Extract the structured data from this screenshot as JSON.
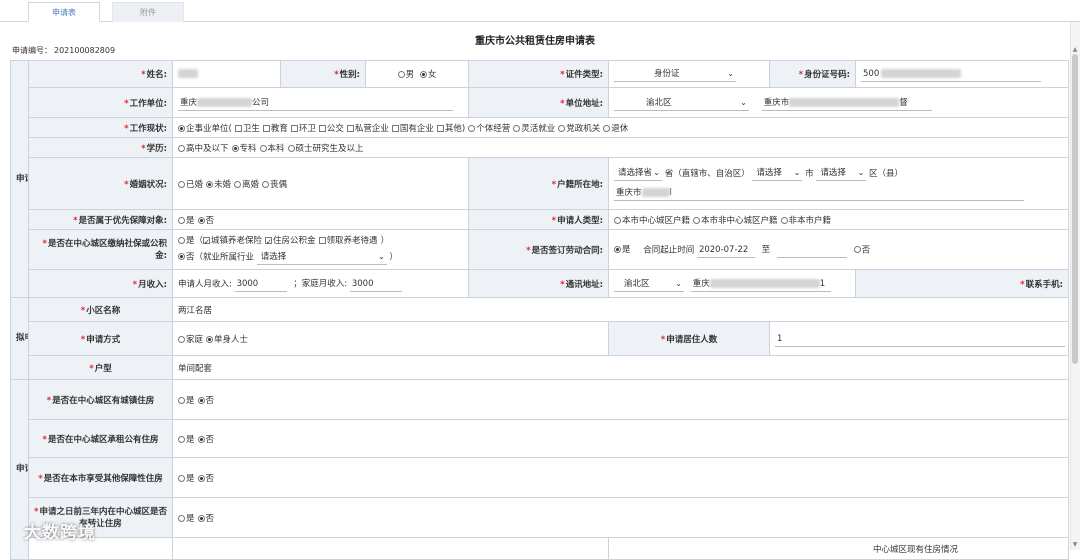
{
  "tabs": [
    "申请表",
    "附件"
  ],
  "form_title": "重庆市公共租赁住房申请表",
  "app_no": {
    "label": "申请编号：",
    "value": "202100082809"
  },
  "sections": {
    "basic": "申请人基本情况",
    "house": "拟申请房屋情况",
    "housing": "申请人及共同申请人住房情况"
  },
  "name": {
    "label": "姓名:"
  },
  "gender": {
    "label": "性别:",
    "options": [
      "男",
      "女"
    ],
    "selected": "女"
  },
  "id_type": {
    "label": "证件类型:",
    "value": "身份证"
  },
  "id_no": {
    "label": "身份证号码:",
    "value": "500"
  },
  "work_unit": {
    "label": "工作单位:",
    "prefix": "重庆",
    "suffix": "公司"
  },
  "unit_address": {
    "label": "单位地址:",
    "district": "渝北区",
    "detail_prefix": "重庆市",
    "detail_suffix": "督"
  },
  "work_status": {
    "label": "工作现状:",
    "items": [
      {
        "t": "radio",
        "on": true,
        "text": "企事业单位("
      },
      {
        "t": "chk",
        "on": false,
        "text": "卫生"
      },
      {
        "t": "chk",
        "on": false,
        "text": "教育"
      },
      {
        "t": "chk",
        "on": false,
        "text": "环卫"
      },
      {
        "t": "chk",
        "on": false,
        "text": "公交"
      },
      {
        "t": "chk",
        "on": false,
        "text": "私营企业"
      },
      {
        "t": "chk",
        "on": false,
        "text": "国有企业"
      },
      {
        "t": "chk",
        "on": false,
        "text": "其他)"
      },
      {
        "t": "radio",
        "on": false,
        "text": "个体经营"
      },
      {
        "t": "radio",
        "on": false,
        "text": "灵活就业"
      },
      {
        "t": "radio",
        "on": false,
        "text": "党政机关"
      },
      {
        "t": "radio",
        "on": false,
        "text": "退休"
      }
    ]
  },
  "education": {
    "label": "学历:",
    "items": [
      {
        "on": false,
        "text": "高中及以下"
      },
      {
        "on": true,
        "text": "专科"
      },
      {
        "on": false,
        "text": "本科"
      },
      {
        "on": false,
        "text": "硕士研究生及以上"
      }
    ]
  },
  "marital": {
    "label": "婚姻状况:",
    "items": [
      {
        "on": false,
        "text": "已婚"
      },
      {
        "on": true,
        "text": "未婚"
      },
      {
        "on": false,
        "text": "离婚"
      },
      {
        "on": false,
        "text": "丧偶"
      }
    ]
  },
  "hukou": {
    "label": "户籍所在地:",
    "sel1": "请选择省",
    "t1": "省（直辖市、自治区）",
    "sel2": "请选择",
    "t2": "市",
    "sel3": "请选择",
    "t3": "区（县）",
    "detail_prefix": "重庆市",
    "detail_suffix": "l"
  },
  "priority": {
    "label": "是否属于优先保障对象:",
    "items": [
      {
        "on": false,
        "text": "是"
      },
      {
        "on": true,
        "text": "否"
      }
    ]
  },
  "applicant_type": {
    "label": "申请人类型:",
    "items": [
      {
        "on": false,
        "text": "本市中心城区户籍"
      },
      {
        "on": false,
        "text": "本市非中心城区户籍"
      },
      {
        "on": false,
        "text": "非本市户籍"
      }
    ]
  },
  "social_ins": {
    "label": "是否在中心城区缴纳社保或公积金:",
    "line1_yes": "是（",
    "checks": [
      {
        "on": true,
        "text": "城镇养老保险"
      },
      {
        "on": true,
        "text": "住房公积金"
      },
      {
        "on": false,
        "text": "领取养老待遇"
      }
    ],
    "line1_end": "）",
    "line2_no": "否（就业所属行业",
    "industry_sel": "请选择",
    "line2_end": "）"
  },
  "contract": {
    "label": "是否签订劳动合同:",
    "yes": "是",
    "period_label": "合同起止时间",
    "start": "2020-07-22",
    "to": "至",
    "no": "否"
  },
  "income": {
    "label": "月收入:",
    "applicant_label": "申请人月收入:",
    "applicant": "3000",
    "family_label": "；家庭月收入:",
    "family": "3000"
  },
  "mail_addr": {
    "label": "通讯地址:",
    "district": "渝北区",
    "detail_prefix": "重庆",
    "detail_suffix": "1"
  },
  "phone": {
    "label": "联系手机:",
    "prefix": "17",
    "suffix": "1"
  },
  "community": {
    "label": "小区名称",
    "value": "两江名居"
  },
  "apply_mode": {
    "label": "申请方式",
    "items": [
      {
        "on": false,
        "text": "家庭"
      },
      {
        "on": true,
        "text": "单身人士"
      }
    ]
  },
  "residents": {
    "label": "申请居住人数",
    "value": "1"
  },
  "layout_type": {
    "label": "户型",
    "value": "单间配套"
  },
  "q1": {
    "label": "是否在中心城区有城镇住房",
    "items": [
      {
        "on": false,
        "text": "是"
      },
      {
        "on": true,
        "text": "否"
      }
    ]
  },
  "q2": {
    "label": "是否在中心城区承租公有住房",
    "items": [
      {
        "on": false,
        "text": "是"
      },
      {
        "on": true,
        "text": "否"
      }
    ]
  },
  "q3": {
    "label": "是否在本市享受其他保障性住房",
    "items": [
      {
        "on": false,
        "text": "是"
      },
      {
        "on": true,
        "text": "否"
      }
    ]
  },
  "q4": {
    "label": "申请之日前三年内在中心城区是否有转让住房",
    "items": [
      {
        "on": false,
        "text": "是"
      },
      {
        "on": true,
        "text": "否"
      }
    ]
  },
  "bottom_partial": "中心城区现有住房情况",
  "watermark": "大数跨境"
}
